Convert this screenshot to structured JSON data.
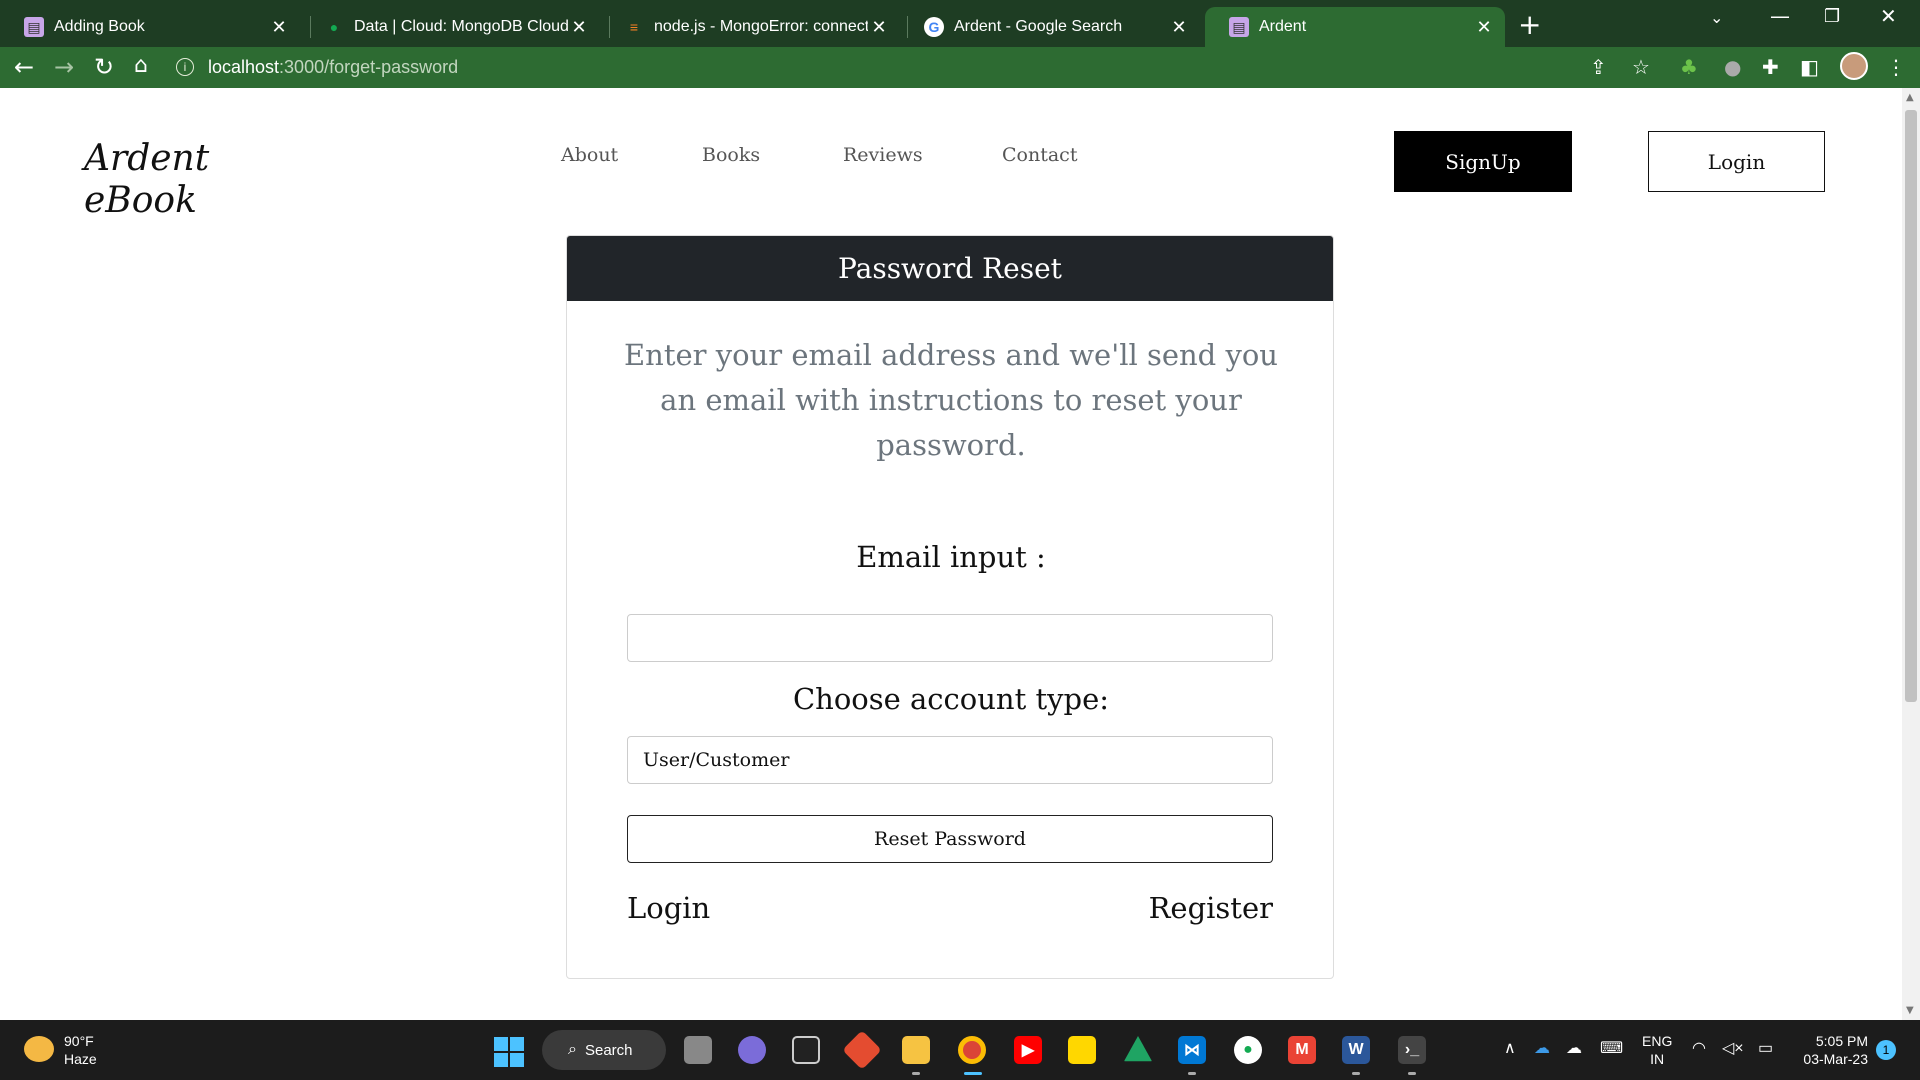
{
  "browser": {
    "tabs": [
      {
        "title": "Adding Book",
        "icon": "book-favicon",
        "active": false
      },
      {
        "title": "Data | Cloud: MongoDB Cloud",
        "icon": "mongodb-leaf-favicon",
        "active": false
      },
      {
        "title": "node.js - MongoError: connect EC",
        "icon": "stackoverflow-favicon",
        "active": false
      },
      {
        "title": "Ardent - Google Search",
        "icon": "google-favicon",
        "active": false
      },
      {
        "title": "Ardent",
        "icon": "book-favicon",
        "active": true
      }
    ],
    "new_tab": "+",
    "url_host": "localhost",
    "url_path": ":3000/forget-password"
  },
  "header": {
    "logo_line1": "Ardent",
    "logo_line2": "eBook",
    "nav": [
      "About",
      "Books",
      "Reviews",
      "Contact"
    ],
    "signup_label": "SignUp",
    "login_label": "Login"
  },
  "card": {
    "title": "Password Reset",
    "description": "Enter your email address and we'll send you an email with instructions to reset your password.",
    "email_label": "Email input :",
    "email_value": "",
    "account_type_label": "Choose account type:",
    "account_type_value": "User/Customer",
    "reset_button": "Reset Password",
    "login_link": "Login",
    "register_link": "Register"
  },
  "taskbar": {
    "weather_temp": "90°F",
    "weather_desc": "Haze",
    "search_label": "Search",
    "lang_line1": "ENG",
    "lang_line2": "IN",
    "time": "5:05 PM",
    "date": "03-Mar-23",
    "notification_count": "1"
  },
  "colors": {
    "tabbar_bg": "#1e3d23",
    "toolbar_bg": "#2d6b32",
    "card_header_bg": "#212529",
    "signup_bg": "#000000",
    "description_text": "#6c757d"
  }
}
